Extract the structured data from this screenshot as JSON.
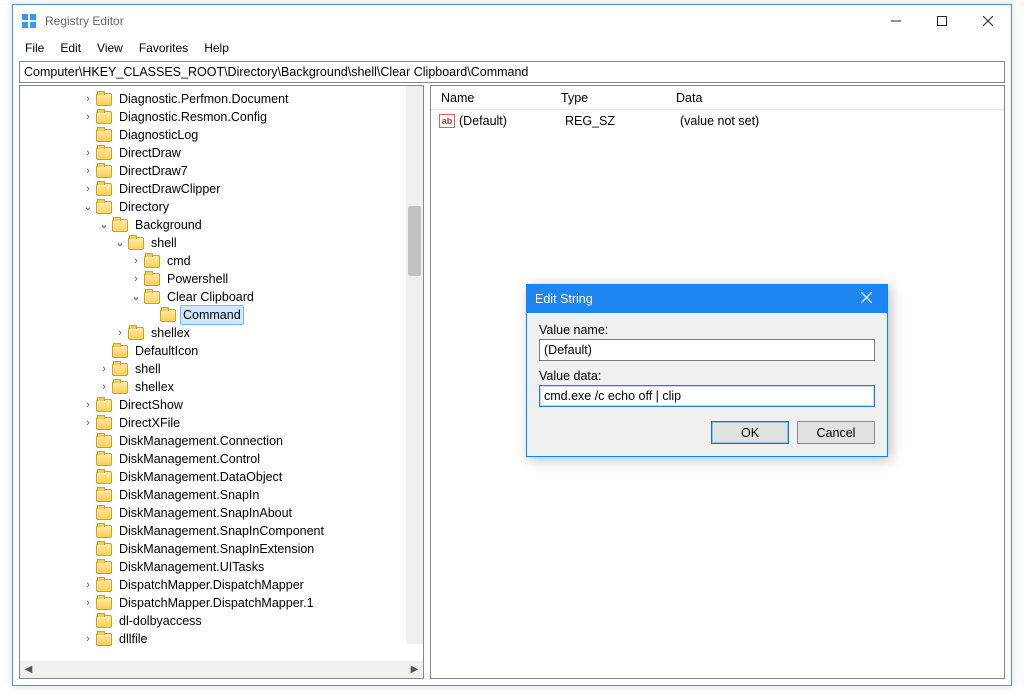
{
  "window": {
    "title": "Registry Editor"
  },
  "menu": {
    "file": "File",
    "edit": "Edit",
    "view": "View",
    "favorites": "Favorites",
    "help": "Help"
  },
  "address": "Computer\\HKEY_CLASSES_ROOT\\Directory\\Background\\shell\\Clear Clipboard\\Command",
  "tree": {
    "items": [
      {
        "indent": 2,
        "tw": ">",
        "label": "Diagnostic.Perfmon.Document"
      },
      {
        "indent": 2,
        "tw": ">",
        "label": "Diagnostic.Resmon.Config"
      },
      {
        "indent": 2,
        "tw": "",
        "label": "DiagnosticLog"
      },
      {
        "indent": 2,
        "tw": ">",
        "label": "DirectDraw"
      },
      {
        "indent": 2,
        "tw": ">",
        "label": "DirectDraw7"
      },
      {
        "indent": 2,
        "tw": ">",
        "label": "DirectDrawClipper"
      },
      {
        "indent": 2,
        "tw": "v",
        "label": "Directory"
      },
      {
        "indent": 3,
        "tw": "v",
        "label": "Background"
      },
      {
        "indent": 4,
        "tw": "v",
        "label": "shell"
      },
      {
        "indent": 5,
        "tw": ">",
        "label": "cmd"
      },
      {
        "indent": 5,
        "tw": ">",
        "label": "Powershell"
      },
      {
        "indent": 5,
        "tw": "v",
        "label": "Clear Clipboard"
      },
      {
        "indent": 6,
        "tw": "",
        "label": "Command",
        "selected": true
      },
      {
        "indent": 4,
        "tw": ">",
        "label": "shellex"
      },
      {
        "indent": 3,
        "tw": "",
        "label": "DefaultIcon"
      },
      {
        "indent": 3,
        "tw": ">",
        "label": "shell"
      },
      {
        "indent": 3,
        "tw": ">",
        "label": "shellex"
      },
      {
        "indent": 2,
        "tw": ">",
        "label": "DirectShow"
      },
      {
        "indent": 2,
        "tw": ">",
        "label": "DirectXFile"
      },
      {
        "indent": 2,
        "tw": "",
        "label": "DiskManagement.Connection"
      },
      {
        "indent": 2,
        "tw": "",
        "label": "DiskManagement.Control"
      },
      {
        "indent": 2,
        "tw": "",
        "label": "DiskManagement.DataObject"
      },
      {
        "indent": 2,
        "tw": "",
        "label": "DiskManagement.SnapIn"
      },
      {
        "indent": 2,
        "tw": "",
        "label": "DiskManagement.SnapInAbout"
      },
      {
        "indent": 2,
        "tw": "",
        "label": "DiskManagement.SnapInComponent"
      },
      {
        "indent": 2,
        "tw": "",
        "label": "DiskManagement.SnapInExtension"
      },
      {
        "indent": 2,
        "tw": "",
        "label": "DiskManagement.UITasks"
      },
      {
        "indent": 2,
        "tw": ">",
        "label": "DispatchMapper.DispatchMapper"
      },
      {
        "indent": 2,
        "tw": ">",
        "label": "DispatchMapper.DispatchMapper.1"
      },
      {
        "indent": 2,
        "tw": "",
        "label": "dl-dolbyaccess"
      },
      {
        "indent": 2,
        "tw": ">",
        "label": "dllfile"
      }
    ]
  },
  "list": {
    "headers": {
      "name": "Name",
      "type": "Type",
      "data": "Data"
    },
    "row": {
      "icon": "ab",
      "name": "(Default)",
      "type": "REG_SZ",
      "data": "(value not set)"
    }
  },
  "dialog": {
    "title": "Edit String",
    "valueNameLabel": "Value name:",
    "valueName": "(Default)",
    "valueDataLabel": "Value data:",
    "valueData": "cmd.exe /c echo off | clip",
    "ok": "OK",
    "cancel": "Cancel"
  }
}
